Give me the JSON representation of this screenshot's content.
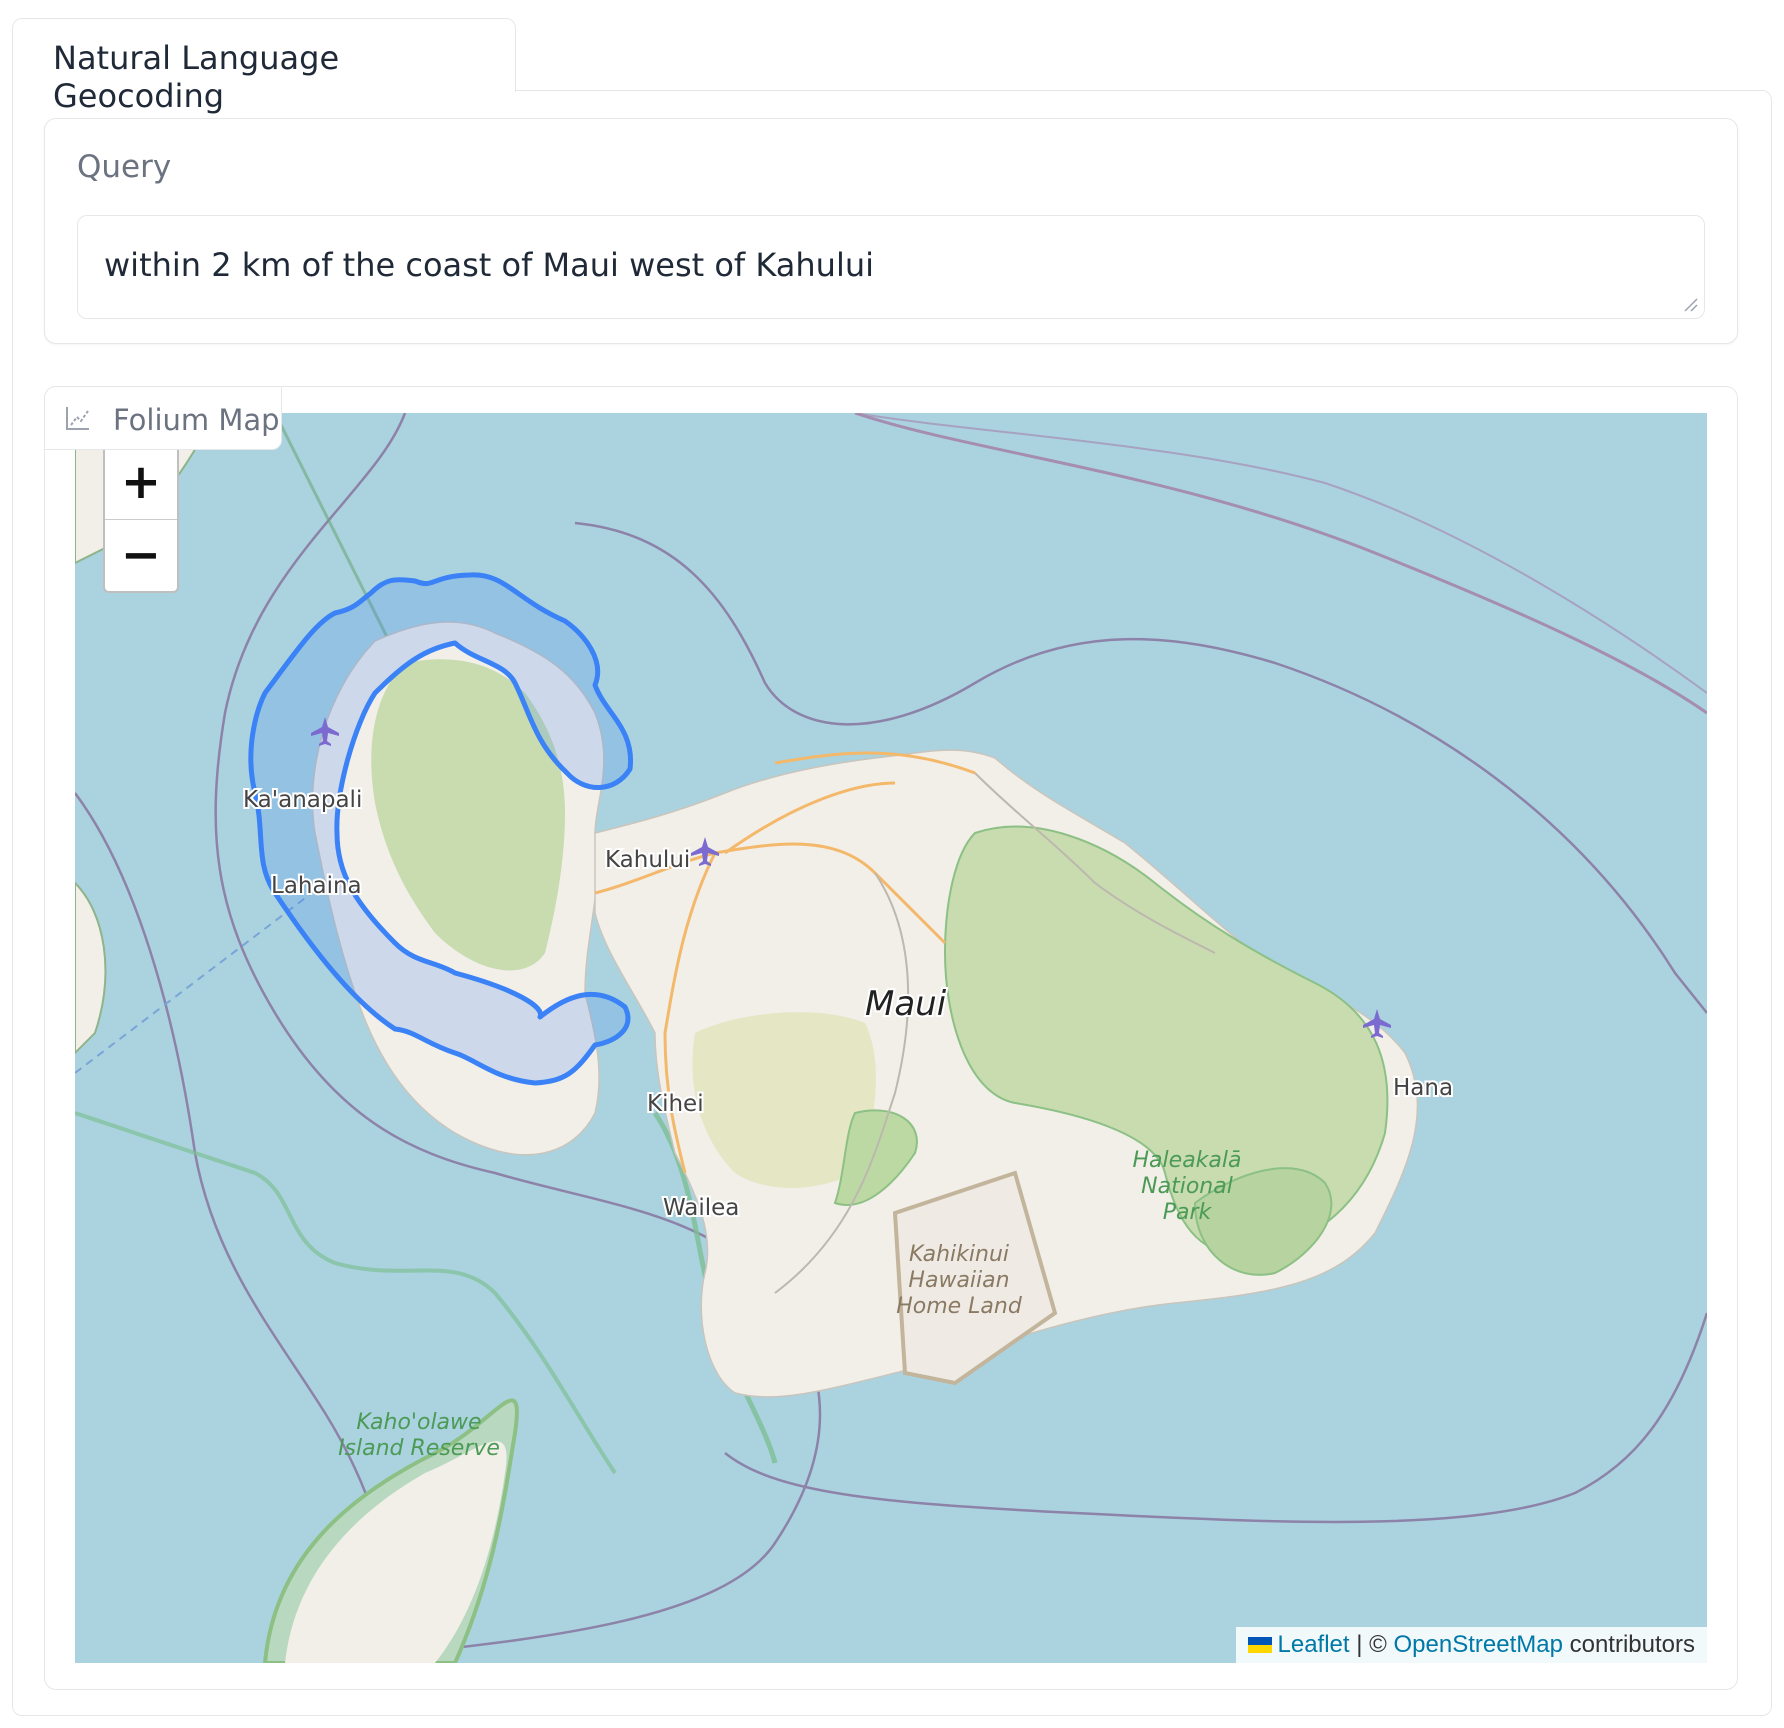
{
  "tab": {
    "label": "Natural Language Geocoding"
  },
  "query": {
    "label": "Query",
    "value": "within 2 km of the coast of Maui west of Kahului"
  },
  "map_block": {
    "label": "Folium Map",
    "zoom_in": "+",
    "zoom_out": "−",
    "places": {
      "kaanapali": "Ka'anapali",
      "lahaina": "Lahaina",
      "kahului": "Kahului",
      "maui": "Maui",
      "kihei": "Kihei",
      "wailea": "Wailea",
      "hana": "Hana",
      "haleakala_1": "Haleakalā",
      "haleakala_2": "National",
      "haleakala_3": "Park",
      "kahikinui_1": "Kahikinui",
      "kahikinui_2": "Hawaiian",
      "kahikinui_3": "Home Land",
      "kahoolawe_1": "Kaho'olawe",
      "kahoolawe_2": "Island Reserve"
    },
    "attribution": {
      "leaflet": "Leaflet",
      "separator": " | © ",
      "osm": "OpenStreetMap",
      "contributors": " contributors"
    },
    "colors": {
      "water": "#aad3df",
      "land": "#f2efe9",
      "forest": "#c8dcb0",
      "park_border": "#8cc084",
      "query_polygon": "#3b82f6"
    }
  }
}
